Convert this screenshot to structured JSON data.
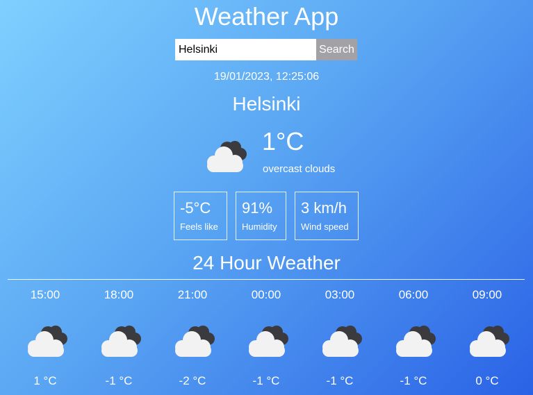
{
  "app": {
    "title": "Weather App"
  },
  "search": {
    "value": "Helsinki",
    "button_label": "Search"
  },
  "current": {
    "datetime": "19/01/2023, 12:25:06",
    "city": "Helsinki",
    "icon": "overcast-clouds-icon",
    "temperature": "1°C",
    "description": "overcast clouds",
    "stats": [
      {
        "value": "-5°C",
        "label": "Feels like"
      },
      {
        "value": "91%",
        "label": "Humidity"
      },
      {
        "value": "3 km/h",
        "label": "Wind speed"
      }
    ]
  },
  "forecast": {
    "title": "24 Hour Weather",
    "hours": [
      {
        "time": "15:00",
        "temp": "1 °C",
        "icon": "overcast-clouds-icon"
      },
      {
        "time": "18:00",
        "temp": "-1 °C",
        "icon": "overcast-clouds-icon"
      },
      {
        "time": "21:00",
        "temp": "-2 °C",
        "icon": "overcast-clouds-icon"
      },
      {
        "time": "00:00",
        "temp": "-1 °C",
        "icon": "overcast-clouds-icon"
      },
      {
        "time": "03:00",
        "temp": "-1 °C",
        "icon": "overcast-clouds-icon"
      },
      {
        "time": "06:00",
        "temp": "-1 °C",
        "icon": "overcast-clouds-icon"
      },
      {
        "time": "09:00",
        "temp": "0 °C",
        "icon": "overcast-clouds-icon"
      }
    ]
  },
  "colors": {
    "background_start": "#7fd0ff",
    "background_end": "#2a62e6",
    "button": "#a2a2a6",
    "cloud_light": "#f2f2f2",
    "cloud_dark": "#3b3b3f"
  }
}
